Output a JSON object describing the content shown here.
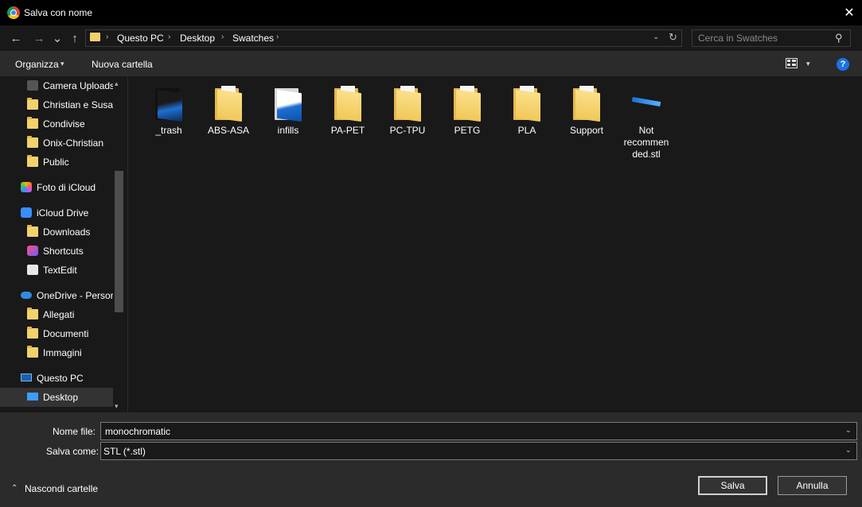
{
  "window": {
    "title": "Salva con nome",
    "close_glyph": "✕"
  },
  "nav": {
    "back_glyph": "←",
    "forward_glyph": "→",
    "recent_glyph": "⌄",
    "up_glyph": "↑",
    "breadcrumb": [
      "Questo PC",
      "Desktop",
      "Swatches"
    ],
    "separator": "›",
    "refresh_glyph": "↻",
    "search_placeholder": "Cerca in Swatches",
    "search_glyph": "⚲"
  },
  "toolbar": {
    "organizza": "Organizza",
    "nuova_cartella": "Nuova cartella",
    "caret": "▾",
    "help": "?"
  },
  "sidebar": {
    "items": [
      {
        "label": "Camera Uploads",
        "icon": "camera-icon"
      },
      {
        "label": "Christian e Susar",
        "icon": "shared-folder-icon"
      },
      {
        "label": "Condivise",
        "icon": "folder-icon"
      },
      {
        "label": "Onix-Christian",
        "icon": "shared-folder-icon"
      },
      {
        "label": "Public",
        "icon": "folder-icon"
      },
      {
        "label": "Foto di iCloud",
        "icon": "icloud-photos-icon"
      },
      {
        "label": "iCloud Drive",
        "icon": "icloud-drive-icon"
      },
      {
        "label": "Downloads",
        "icon": "folder-icon"
      },
      {
        "label": "Shortcuts",
        "icon": "shortcuts-icon"
      },
      {
        "label": "TextEdit",
        "icon": "textedit-icon"
      },
      {
        "label": "OneDrive - Persor",
        "icon": "onedrive-icon"
      },
      {
        "label": "Allegati",
        "icon": "folder-icon"
      },
      {
        "label": "Documenti",
        "icon": "folder-icon"
      },
      {
        "label": "Immagini",
        "icon": "folder-icon"
      },
      {
        "label": "Questo PC",
        "icon": "computer-icon"
      },
      {
        "label": "Desktop",
        "icon": "desktop-icon"
      }
    ],
    "scroll_up": "▴",
    "scroll_down": "▾"
  },
  "files": [
    {
      "name": "_trash",
      "type": "folder-dark"
    },
    {
      "name": "ABS-ASA",
      "type": "folder"
    },
    {
      "name": "infills",
      "type": "folder-white"
    },
    {
      "name": "PA-PET",
      "type": "folder"
    },
    {
      "name": "PC-TPU",
      "type": "folder"
    },
    {
      "name": "PETG",
      "type": "folder"
    },
    {
      "name": "PLA",
      "type": "folder"
    },
    {
      "name": "Support",
      "type": "folder"
    },
    {
      "name": "Not recommended.stl",
      "type": "stl"
    }
  ],
  "form": {
    "nome_label": "Nome file:",
    "nome_value": "monochromatic",
    "salva_come_label": "Salva come:",
    "salva_come_value": "STL (*.stl)",
    "dropdown_glyph": "⌄"
  },
  "footer": {
    "hide_folders": "Nascondi cartelle",
    "hide_caret": "⌃",
    "save_button": "Salva",
    "cancel_button": "Annulla"
  }
}
